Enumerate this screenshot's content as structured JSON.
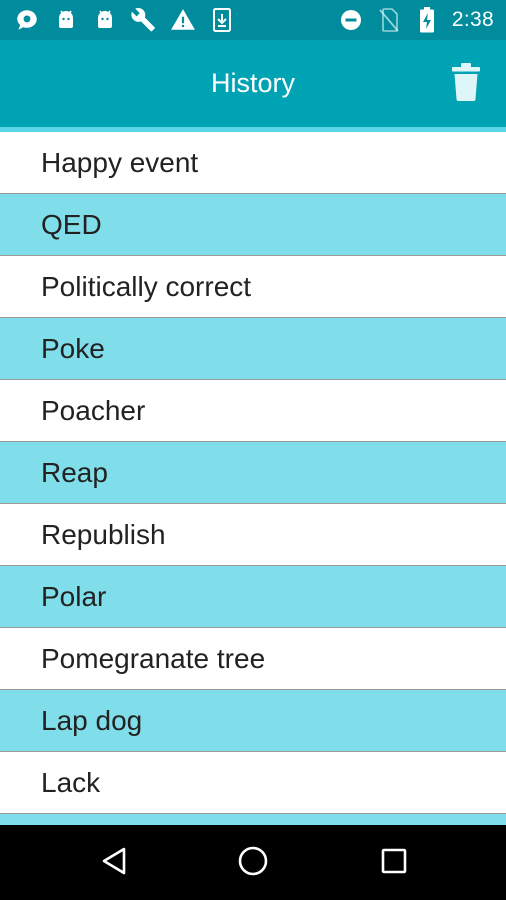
{
  "status_bar": {
    "time": "2:38",
    "left_icons": [
      "chat-bubble-icon",
      "android-icon",
      "android-icon",
      "wrench-icon",
      "warning-icon",
      "download-icon"
    ],
    "right_icons": [
      "do-not-disturb-icon",
      "no-sim-icon",
      "battery-charging-icon"
    ]
  },
  "app_bar": {
    "title": "History",
    "action_icon": "trash-icon"
  },
  "history": {
    "items": [
      "Happy event",
      "QED",
      "Politically correct",
      "Poke",
      "Poacher",
      "Reap",
      "Republish",
      "Polar",
      "Pomegranate tree",
      "Lap dog",
      "Lack"
    ]
  },
  "colors": {
    "status_bar": "#008c9c",
    "app_bar": "#00a3b3",
    "row_alt": "#80deea",
    "row_plain": "#ffffff",
    "nav_bar": "#000000"
  },
  "nav_bar": {
    "buttons": [
      "back-icon",
      "home-icon",
      "recents-icon"
    ]
  }
}
